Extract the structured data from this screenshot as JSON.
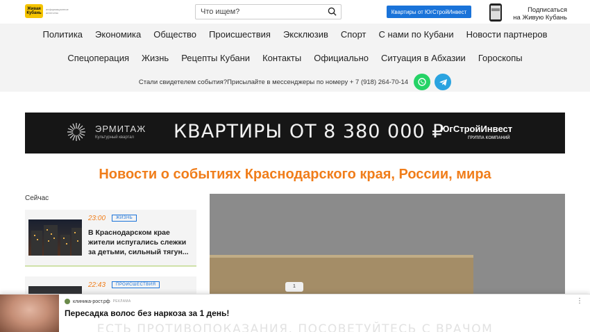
{
  "header": {
    "logo_text": "Живая Кубань",
    "logo_tagline": "информационное агентство",
    "search_placeholder": "Что ищем?",
    "promo_button": "Квартиры от ЮгСтройИнвест",
    "subscribe_line1": "Подписаться",
    "subscribe_line2": "на Живую Кубань"
  },
  "nav": {
    "row1": [
      "Политика",
      "Экономика",
      "Общество",
      "Происшествия",
      "Эксклюзив",
      "Спорт",
      "С нами по Кубани",
      "Новости партнеров"
    ],
    "row2": [
      "Спецоперация",
      "Жизнь",
      "Рецепты Кубани",
      "Контакты",
      "Официально",
      "Ситуация в Абхазии",
      "Гороскопы"
    ]
  },
  "witness": {
    "text": "Стали свидетелем события?Присылайте в мессенджеры по номеру + 7 (918) 264-70-14"
  },
  "banner": {
    "brand": "ЭРМИТАЖ",
    "brand_sub": "Культурный квартал",
    "headline": "КВАРТИРЫ ОТ 8 380 000 ₽",
    "developer": "ЮгСтройИнвест",
    "developer_sub": "ГРУППА КОМПАНИЙ"
  },
  "main": {
    "title": "Новости о событиях Краснодарского края, России, мира",
    "now_label": "Сейчас",
    "news": [
      {
        "time": "23:00",
        "tag": "ЖИЗНЬ",
        "text": "В Краснодарском крае жители испугались слежки за детьми, сильный тягун..."
      },
      {
        "time": "22:43",
        "tag": "ПРОИСШЕСТВИЯ",
        "text": ""
      }
    ],
    "slider_index": "1"
  },
  "ad": {
    "source": "клиника-рост.рф",
    "label": "РЕКЛАМА",
    "menu": "⋮",
    "title": "Пересадка волос без наркоза за 1 день!",
    "disclaimer": "ЕСТЬ ПРОТИВОПОКАЗАНИЯ. ПОСОВЕТУЙТЕСЬ С ВРАЧОМ"
  },
  "colors": {
    "accent": "#f07d1a",
    "link_blue": "#1a73d9",
    "whatsapp": "#25d366",
    "telegram": "#2aa3e0"
  }
}
